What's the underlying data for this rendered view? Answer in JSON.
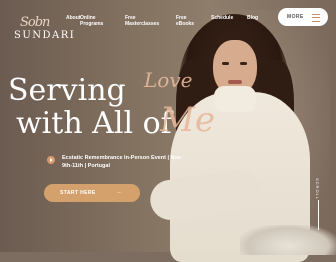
{
  "brand": {
    "logo_script": "Sobn",
    "logo_word": "SUNDARI"
  },
  "nav": {
    "items": [
      {
        "label": "About"
      },
      {
        "label": "Online\nPrograms"
      },
      {
        "label": "Free\nMasterclasses"
      },
      {
        "label": "Free\neBooks"
      },
      {
        "label": "Schedule"
      },
      {
        "label": "Blog"
      }
    ],
    "more_label": "MORE"
  },
  "hero": {
    "heading_line1": "Serving",
    "heading_line2": "with All of",
    "script_love": "Love",
    "script_me": "Me",
    "event_text": "Ecstatic Remembrance In-Person Event | Nov 9th-11th | Portugal",
    "cta_label": "START HERE",
    "scroll_label": "SCROLL"
  },
  "colors": {
    "accent": "#d4a06c",
    "script": "#e8b89a"
  }
}
